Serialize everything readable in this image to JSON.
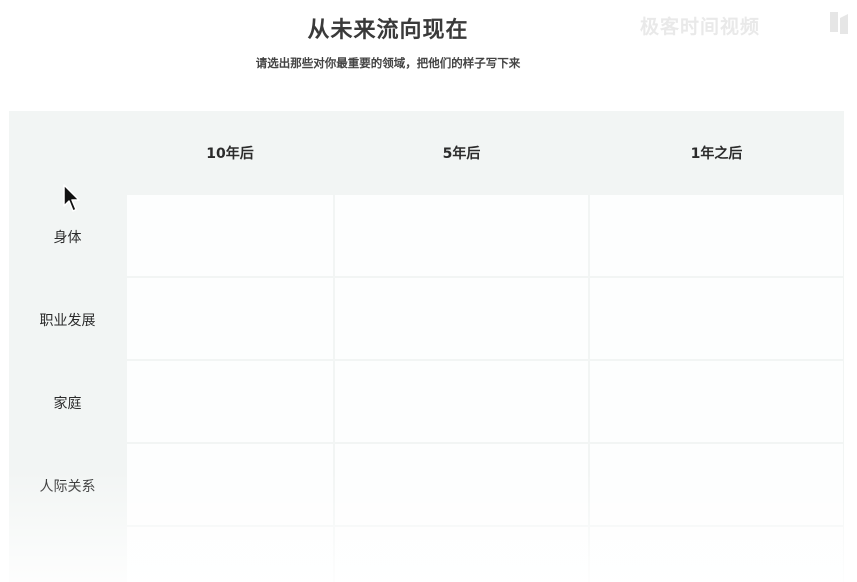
{
  "title": "从未来流向现在",
  "subtitle": "请选出那些对你最重要的领域，把他们的样子写下来",
  "watermark": "极客时间视频",
  "table": {
    "columns": [
      "10年后",
      "5年后",
      "1年之后"
    ],
    "rows": [
      "身体",
      "职业发展",
      "家庭",
      "人际关系",
      ""
    ]
  },
  "icons": {
    "cursor": "mouse-pointer-icon",
    "watermark": "geektime-logo-icon"
  },
  "colors": {
    "grid_background": "#f2f5f4",
    "cell_background": "#fdfefe",
    "text": "#2b2b2b"
  }
}
